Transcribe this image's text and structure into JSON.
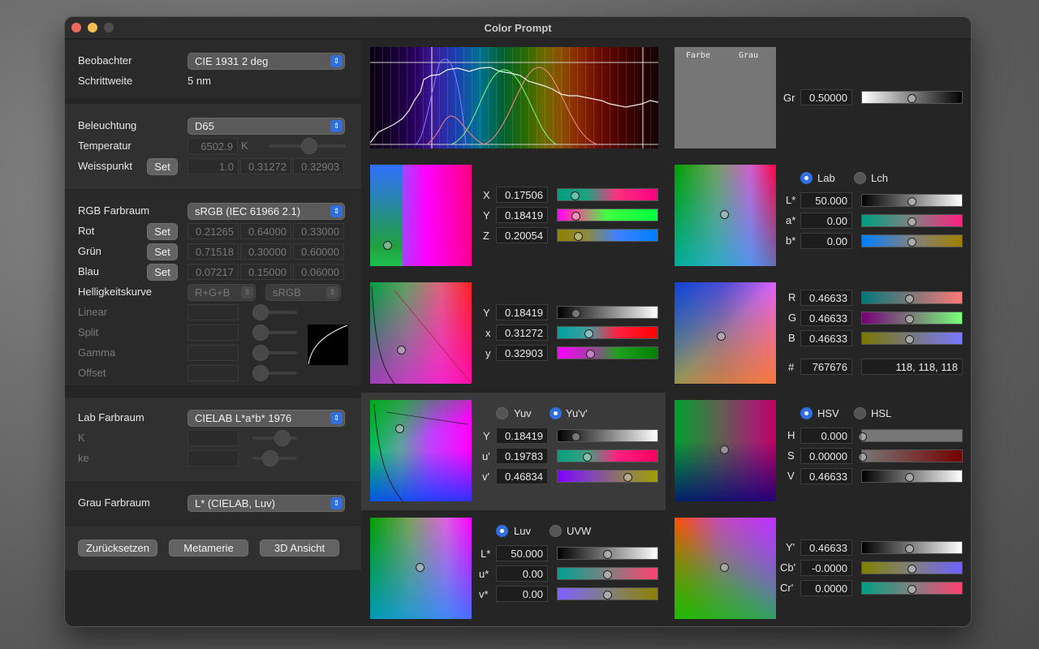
{
  "window": {
    "title": "Color Prompt"
  },
  "left": {
    "observer": {
      "label": "Beobachter",
      "value": "CIE 1931 2 deg"
    },
    "step": {
      "label": "Schrittweite",
      "value": "5 nm"
    },
    "illuminant": {
      "label": "Beleuchtung",
      "value": "D65"
    },
    "temperature": {
      "label": "Temperatur",
      "value": "6502.9",
      "unit": "K"
    },
    "whitepoint": {
      "label": "Weisspunkt",
      "set": "Set",
      "v1": "1.0",
      "v2": "0.31272",
      "v3": "0.32903"
    },
    "rgb_space": {
      "label": "RGB Farbraum",
      "value": "sRGB (IEC 61966 2.1)"
    },
    "red": {
      "label": "Rot",
      "set": "Set",
      "v1": "0.21265",
      "v2": "0.64000",
      "v3": "0.33000"
    },
    "green": {
      "label": "Grün",
      "set": "Set",
      "v1": "0.71518",
      "v2": "0.30000",
      "v3": "0.60000"
    },
    "blue": {
      "label": "Blau",
      "set": "Set",
      "v1": "0.07217",
      "v2": "0.15000",
      "v3": "0.06000"
    },
    "curve": {
      "label": "Helligkeitskurve",
      "mode": "R+G+B",
      "preset": "sRGB"
    },
    "linear": "Linear",
    "split": "Split",
    "gamma": "Gamma",
    "offset": "Offset",
    "lab_space": {
      "label": "Lab Farbraum",
      "value": "CIELAB L*a*b* 1976"
    },
    "k": "K",
    "ke": "ke",
    "gray_space": {
      "label": "Grau Farbraum",
      "value": "L* (CIELAB, Luv)"
    },
    "buttons": {
      "reset": "Zurücksetzen",
      "metamerism": "Metamerie",
      "view3d": "3D Ansicht"
    }
  },
  "preview": {
    "color_label": "Farbe",
    "gray_label": "Grau",
    "gray_color": "#767676"
  },
  "gray": {
    "label": "Gr",
    "value": "0.50000",
    "level": 0.5
  },
  "xyz": {
    "x_label": "X",
    "x": "0.17506",
    "y_label": "Y",
    "y": "0.18419",
    "z_label": "Z",
    "z": "0.20054"
  },
  "lab": {
    "opt1": "Lab",
    "opt2": "Lch",
    "l_label": "L*",
    "l": "50.000",
    "a_label": "a*",
    "a": "0.00",
    "b_label": "b*",
    "b": "0.00"
  },
  "yxy": {
    "y_label": "Y",
    "y": "0.18419",
    "x2_label": "x",
    "x2": "0.31272",
    "y2_label": "y",
    "y2": "0.32903"
  },
  "rgb": {
    "r_label": "R",
    "r": "0.46633",
    "g_label": "G",
    "g": "0.46633",
    "b_label": "B",
    "b": "0.46633",
    "hash_label": "#",
    "hex": "767676",
    "triplet": "118, 118, 118"
  },
  "yuv": {
    "opt1": "Yuv",
    "opt2": "Yu'v'",
    "y_label": "Y",
    "y": "0.18419",
    "u_label": "u'",
    "u": "0.19783",
    "v_label": "v'",
    "v": "0.46834"
  },
  "hsv": {
    "opt1": "HSV",
    "opt2": "HSL",
    "h_label": "H",
    "h": "0.000",
    "s_label": "S",
    "s": "0.00000",
    "v_label": "V",
    "v": "0.46633"
  },
  "luv": {
    "opt1": "Luv",
    "opt2": "UVW",
    "l_label": "L*",
    "l": "50.000",
    "u_label": "u*",
    "u": "0.00",
    "v_label": "v*",
    "v": "0.00"
  },
  "ycbcr": {
    "y_label": "Y'",
    "y": "0.46633",
    "cb_label": "Cb'",
    "cb": "-0.0000",
    "cr_label": "Cr'",
    "cr": "0.0000"
  }
}
